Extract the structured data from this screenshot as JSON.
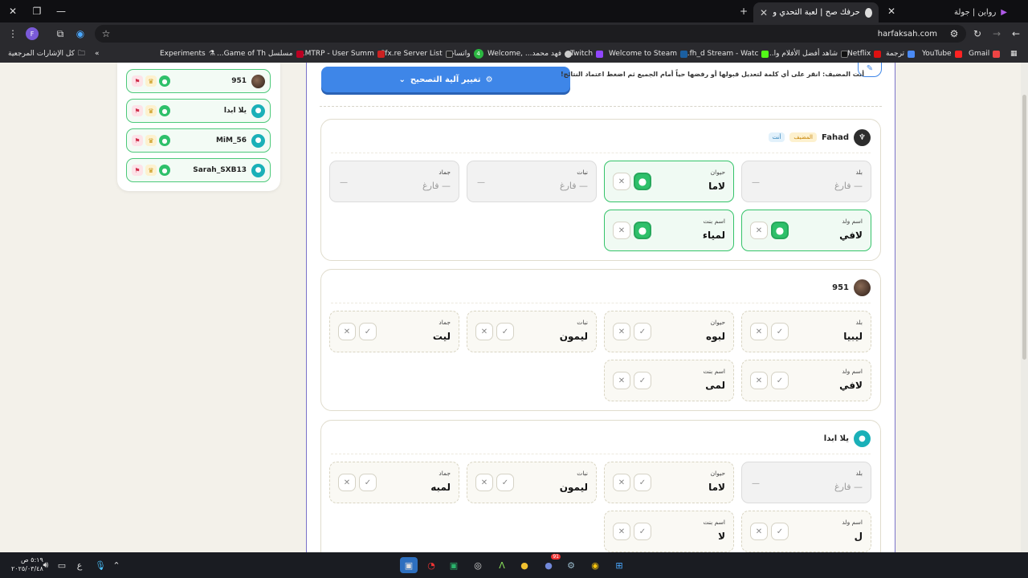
{
  "tabs": [
    {
      "title": "رواين | جولة"
    },
    {
      "title": "حرفك صح | لعبة التحدي والكلمات"
    }
  ],
  "url": "harfaksah.com",
  "bookmarks": [
    "Gmail",
    "YouTube",
    "ترجمة",
    "Netflix",
    "شاهد أفضل الأفلام وا...",
    "fh_d Stream - Watc...",
    "Welcome to Steam",
    "Twitch",
    "فهد محمد... ,Welcome",
    "واتساب",
    "Cfx.re Server List",
    "MTRP - User Summ...",
    "مسلسل Game of Th...",
    "Experiments",
    "كل الإشارات المرجعية"
  ],
  "whatsapp_badge": "4",
  "sidebar": {
    "players": [
      "951",
      "يلا ابدا",
      "MiM_56",
      "Sarah_SXB13"
    ]
  },
  "main": {
    "button": "تغيير آلية التصحيح",
    "host_note": "أنت المضيف: انقر على أي كلمة لتعديل قبولها أو رفضها حياً أمام الجميع ثم اضغط اعتماد النتائج!",
    "cards": [
      {
        "name": "Fahad",
        "host_tag": "المضيف",
        "you_tag": "أنت",
        "cells": [
          {
            "label": "بلد",
            "value": "— فارغ"
          },
          {
            "label": "حيوان",
            "value": "لاما"
          },
          {
            "label": "نبات",
            "value": "— فارغ"
          },
          {
            "label": "جماد",
            "value": "— فارغ"
          },
          {
            "label": "اسم ولد",
            "value": "لافي"
          },
          {
            "label": "اسم بنت",
            "value": "لمياء"
          }
        ]
      },
      {
        "name": "951",
        "cells": [
          {
            "label": "بلد",
            "value": "ليبيا"
          },
          {
            "label": "حيوان",
            "value": "لبوه"
          },
          {
            "label": "نبات",
            "value": "ليمون"
          },
          {
            "label": "جماد",
            "value": "ليت"
          },
          {
            "label": "اسم ولد",
            "value": "لافي"
          },
          {
            "label": "اسم بنت",
            "value": "لمى"
          }
        ]
      },
      {
        "name": "يلا ابدا",
        "cells": [
          {
            "label": "بلد",
            "value": "— فارغ"
          },
          {
            "label": "حيوان",
            "value": "لاما"
          },
          {
            "label": "نبات",
            "value": "ليمون"
          },
          {
            "label": "جماد",
            "value": "لمبه"
          },
          {
            "label": "اسم ولد",
            "value": "ل"
          },
          {
            "label": "اسم بنت",
            "value": "لا"
          }
        ]
      }
    ]
  },
  "taskbar": {
    "time": "٥:١٩ ص",
    "date": "٢٠٢٥/٠٣/٤٨",
    "lang": "ع",
    "discord_badge": "91"
  }
}
